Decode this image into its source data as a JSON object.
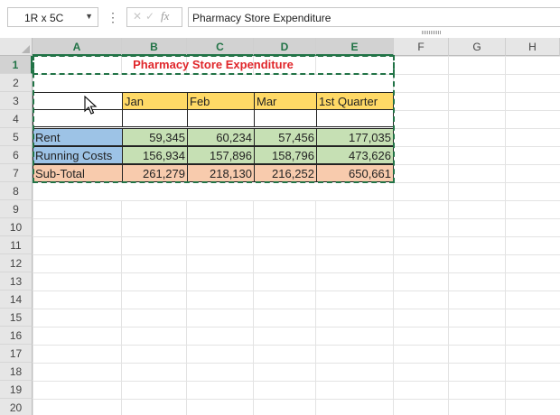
{
  "name_box": {
    "value": "1R x 5C"
  },
  "formula_bar": {
    "cancel_icon": "✕",
    "enter_icon": "✓",
    "fx_label": "fx",
    "value": "Pharmacy Store Expenditure"
  },
  "columns": [
    "A",
    "B",
    "C",
    "D",
    "E",
    "F",
    "G",
    "H"
  ],
  "rows": [
    "1",
    "2",
    "3",
    "4",
    "5",
    "6",
    "7",
    "8",
    "9",
    "10",
    "11",
    "12",
    "13",
    "14",
    "15",
    "16",
    "17",
    "18",
    "19",
    "20"
  ],
  "selection": {
    "rows": [
      "1"
    ],
    "columns": [
      "A",
      "B",
      "C",
      "D",
      "E"
    ]
  },
  "sheet": {
    "title": "Pharmacy Store Expenditure",
    "months": [
      "Jan",
      "Feb",
      "Mar",
      "1st Quarter"
    ],
    "table": [
      {
        "label": "Rent",
        "values": [
          "59,345",
          "60,234",
          "57,456",
          "177,035"
        ]
      },
      {
        "label": "Running Costs",
        "values": [
          "156,934",
          "157,896",
          "158,796",
          "473,626"
        ]
      },
      {
        "label": "Sub-Total",
        "values": [
          "261,279",
          "218,130",
          "216,252",
          "650,661"
        ]
      }
    ]
  },
  "colors": {
    "title": "#e0272b",
    "header_fill": "#ffd966",
    "label_fill": "#9dc3e6",
    "value_fill": "#c6e0b4",
    "subtotal_fill": "#f8cbad",
    "selection": "#217346"
  }
}
